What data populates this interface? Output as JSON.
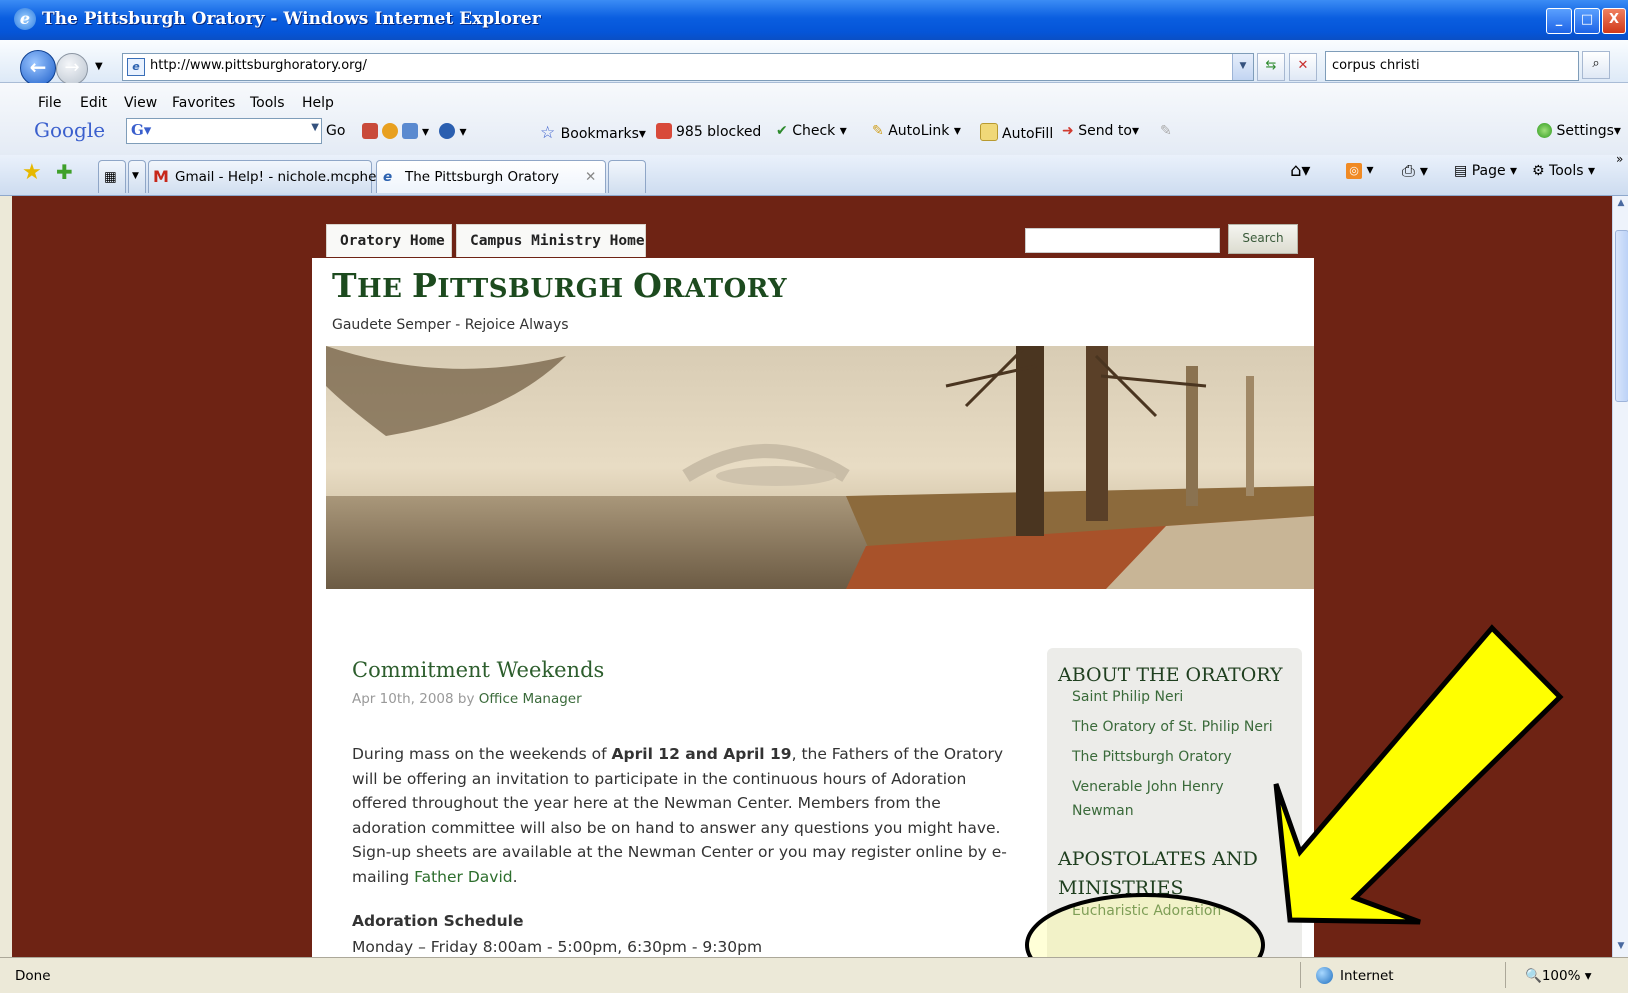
{
  "window": {
    "title": "The Pittsburgh Oratory - Windows Internet Explorer"
  },
  "address": {
    "url": "http://www.pittsburghoratory.org/"
  },
  "search": {
    "value": "corpus christi"
  },
  "menu": [
    "File",
    "Edit",
    "View",
    "Favorites",
    "Tools",
    "Help"
  ],
  "google_toolbar": {
    "logo": "Google",
    "go": "Go",
    "bookmarks": "Bookmarks",
    "blocked": "985 blocked",
    "check": "Check",
    "autolink": "AutoLink",
    "autofill": "AutoFill",
    "send_to": "Send to",
    "settings": "Settings"
  },
  "tabs": [
    {
      "label": "Gmail - Help! - nichole.mcphe..."
    },
    {
      "label": "The Pittsburgh Oratory"
    }
  ],
  "command_bar": {
    "page": "Page",
    "tools": "Tools"
  },
  "site": {
    "nav": [
      "Oratory Home",
      "Campus Ministry Home"
    ],
    "search_button": "Search",
    "title_first": "T",
    "title_rest1": "HE ",
    "title_p": "P",
    "title_rest2": "ITTSBURGH ",
    "title_o": "O",
    "title_rest3": "RATORY",
    "tagline": "Gaudete Semper - Rejoice Always",
    "post": {
      "title": "Commitment Weekends",
      "date": "Apr 10th, 2008 by ",
      "author": "Office Manager",
      "p1_a": "During mass on the weekends of ",
      "p1_bold": "April 12 and April 19",
      "p1_b": ", the Fathers of the Oratory will be offering an invitation to participate in the continuous hours of Adoration offered throughout the year here at the Newman Center. Members from the adoration committee will also be on hand to answer any questions you might have. Sign-up sheets are available at the Newman Center or you may register online by e-mailing ",
      "p1_link": "Father David",
      "p1_end": ".",
      "schedule_heading": "Adoration Schedule",
      "schedule_line": "Monday – Friday 8:00am - 5:00pm, 6:30pm - 9:30pm"
    },
    "sidebar": {
      "about_heading": "ABOUT THE ORATORY",
      "about_links": [
        "Saint Philip Neri",
        "The Oratory of St. Philip Neri",
        "The Pittsburgh Oratory",
        "Venerable John Henry",
        "Newman"
      ],
      "apostolates_heading_1": "APOSTOLATES AND",
      "apostolates_heading_2": "MINISTRIES",
      "apostolates_links": [
        "Eucharistic Adoration"
      ]
    }
  },
  "status": {
    "text": "Done",
    "zone": "Internet",
    "zoom": "100%"
  },
  "colors": {
    "page_bg": "#6e2314",
    "title_green": "#1c4a1e",
    "arrow": "#ffff00"
  }
}
